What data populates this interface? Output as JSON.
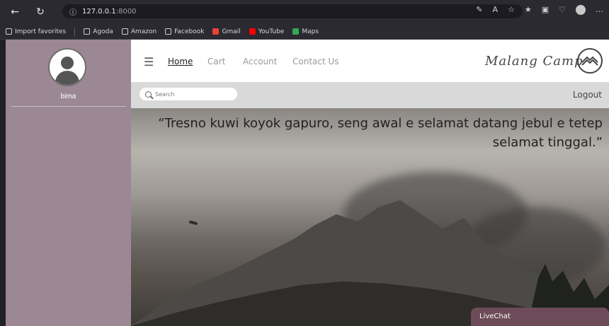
{
  "browser": {
    "url": "127.0.0.1",
    "url_port": ":8000",
    "favorites": [
      "Import favorites",
      "Agoda",
      "Amazon",
      "Facebook",
      "Gmail",
      "YouTube",
      "Maps"
    ]
  },
  "sidebar": {
    "username": "bima"
  },
  "navbar": {
    "links": [
      "Home",
      "Cart",
      "Account",
      "Contact Us"
    ],
    "brand": "Malang Camp"
  },
  "subbar": {
    "search_placeholder": "Search",
    "logout": "Logout"
  },
  "hero": {
    "quote": "“Tresno kuwi koyok gapuro, seng awal e selamat datang jebul e tetep selamat tinggal.”"
  },
  "livechat": {
    "label": "LiveChat"
  }
}
